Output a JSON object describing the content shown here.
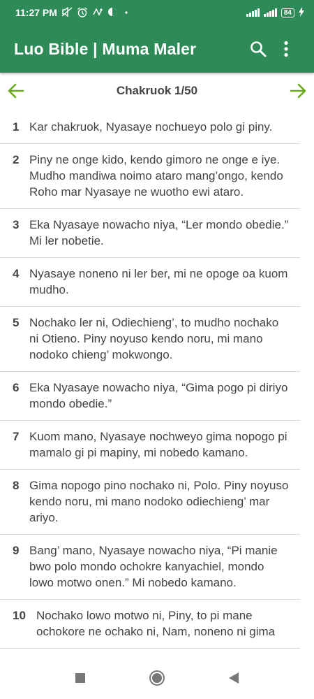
{
  "status": {
    "time": "11:27 PM",
    "battery": "84",
    "icons": [
      "mute-icon",
      "alarm-icon",
      "sync-icon",
      "data-icon",
      "dot-icon"
    ]
  },
  "app": {
    "title": "Luo Bible | Muma Maler",
    "accent": "#2e8b57"
  },
  "chapter": {
    "title": "Chakruok 1/50",
    "arrow_color": "#6aaa1e"
  },
  "verses": [
    {
      "num": "1",
      "text": "Kar chakruok, Nyasaye nochueyo polo gi piny."
    },
    {
      "num": "2",
      "text": "Piny ne onge kido, kendo gimoro ne onge e iye. Mudho mandiwa noimo ataro mang’ongo, kendo Roho mar Nyasaye ne wuotho ewi ataro."
    },
    {
      "num": "3",
      "text": "Eka Nyasaye nowacho niya, “Ler mondo obedie.” Mi ler nobetie."
    },
    {
      "num": "4",
      "text": "Nyasaye noneno ni ler ber, mi ne opoge oa kuom mudho."
    },
    {
      "num": "5",
      "text": "Nochako ler ni, Odiechieng’, to mudho nochako ni Otieno. Piny noyuso kendo noru, mi mano nodoko chieng’ mokwongo."
    },
    {
      "num": "6",
      "text": "Eka Nyasaye nowacho niya, “Gima pogo pi diriyo mondo obedie.”"
    },
    {
      "num": "7",
      "text": "Kuom mano, Nyasaye nochweyo gima nopogo pi mamalo gi pi mapiny, mi nobedo kamano."
    },
    {
      "num": "8",
      "text": "Gima nopogo pino nochako ni, Polo. Piny noyuso kendo noru, mi mano nodoko odiechieng’ mar ariyo."
    },
    {
      "num": "9",
      "text": "Bang’ mano, Nyasaye nowacho niya, “Pi manie bwo polo mondo ochokre kanyachiel, mondo lowo motwo onen.” Mi nobedo kamano."
    },
    {
      "num": "10",
      "text": "Nochako lowo motwo ni, Piny, to pi mane ochokore ne ochako ni, Nam, noneno ni gima"
    }
  ]
}
